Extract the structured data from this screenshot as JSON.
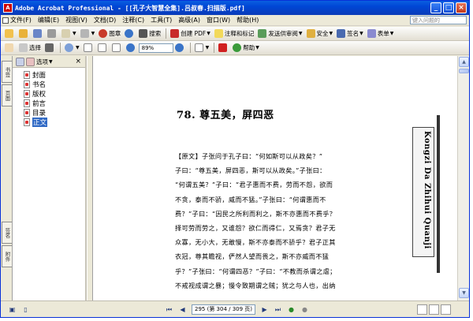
{
  "window": {
    "title": "Adobe Acrobat Professional - [[孔子大智慧全集].吕叔春.扫描版.pdf]",
    "app_icon": "A",
    "min_label": "_",
    "max_label": "□",
    "close_label": "×"
  },
  "menubar": {
    "items": [
      "文件(F)",
      "编辑(E)",
      "视图(V)",
      "文档(D)",
      "注释(C)",
      "工具(T)",
      "高级(A)",
      "窗口(W)",
      "帮助(H)"
    ],
    "help_placeholder": "键入问题的"
  },
  "toolbar1": {
    "search_label": "搜索",
    "stamp_label": "图章",
    "create_pdf": "创建 PDF",
    "comment_label": "注释和标记",
    "send_label": "发送供审阅",
    "secure_label": "安全",
    "sign_label": "签名",
    "forms_label": "表单"
  },
  "toolbar2": {
    "select_label": "选择",
    "zoom_value": "89%",
    "help_label": "帮助"
  },
  "left_tabs": {
    "top": [
      "书签",
      "页面"
    ],
    "bottom": [
      "签名",
      "附件"
    ]
  },
  "nav_panel": {
    "options_label": "选项",
    "close_label": "×",
    "bookmarks": [
      "封面",
      "书名",
      "版权",
      "前言",
      "目录",
      "正文"
    ],
    "selected_index": 5
  },
  "document": {
    "heading": "78. 尊五美，屏四恶",
    "lines": [
      "【原文】子张问于孔子曰：“何如斯可以从政矣？”",
      "子曰：“尊五美，屏四恶，斯可以从政矣。”子张曰：",
      "“何谓五美？”子曰：“君子惠而不费，劳而不怨，欲而",
      "不贪，泰而不骄，威而不猛。”子张曰：“何谓惠而不",
      "费？”子曰：“因民之所利而利之，斯不亦惠而不费乎？",
      "择可劳而劳之，又谁怨？欲仁而得仁，又焉贪？君子无",
      "众寡，无小大，无敢慢，斯不亦泰而不骄乎？君子正其",
      "衣冠，尊其瞻视，俨然人望而畏之，斯不亦威而不猛",
      "乎？”子张曰：“何谓四恶？”子曰：“不教而杀谓之虐；",
      "不戒视成谓之暴；慢令致期谓之贼；犹之与人也，出纳"
    ],
    "side_label": "Kongzi Da Zhihui Quanji"
  },
  "statusbar": {
    "page_indicator": "295 (第 304 / 309 页)"
  }
}
